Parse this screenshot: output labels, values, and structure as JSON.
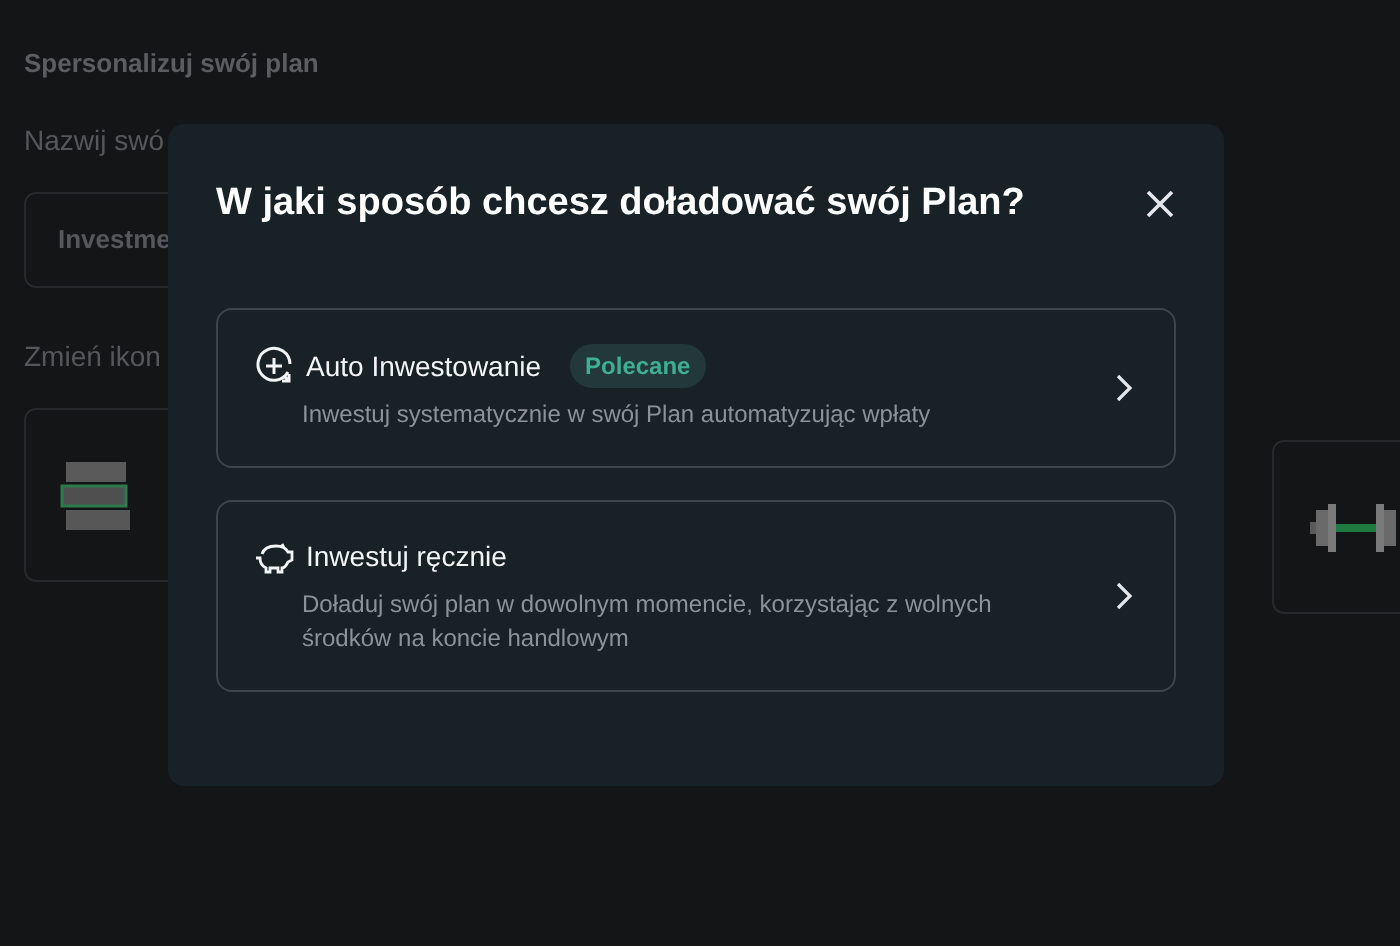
{
  "page": {
    "title": "Spersonalizuj swój plan",
    "name_label": "Nazwij swó",
    "name_value": "Investme",
    "icon_label": "Zmień ikon"
  },
  "dialog": {
    "title": "W jaki sposób chcesz doładować swój Plan?",
    "options": [
      {
        "kind": "auto",
        "title": "Auto Inwestowanie",
        "badge": "Polecane",
        "description": "Inwestuj systematycznie w swój Plan automatyzując wpłaty"
      },
      {
        "kind": "manual",
        "title": "Inwestuj ręcznie",
        "description": "Doładuj swój plan w dowolnym momencie, korzystając z wolnych środków na koncie handlowym"
      }
    ]
  }
}
